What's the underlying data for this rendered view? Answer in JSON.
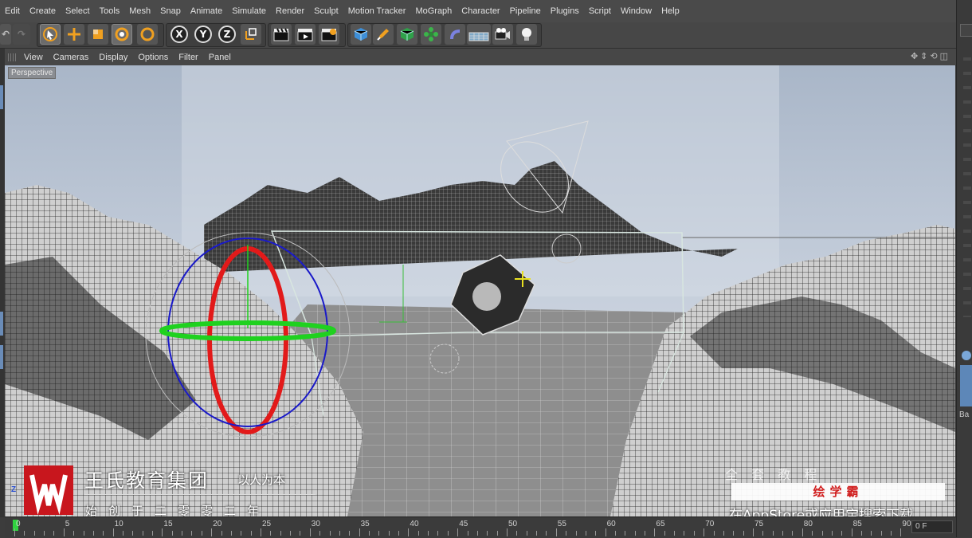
{
  "menubar": {
    "items": [
      "Edit",
      "Create",
      "Select",
      "Tools",
      "Mesh",
      "Snap",
      "Animate",
      "Simulate",
      "Render",
      "Sculpt",
      "Motion Tracker",
      "MoGraph",
      "Character",
      "Pipeline",
      "Plugins",
      "Script",
      "Window",
      "Help"
    ]
  },
  "toolbar": {
    "axis_x": "X",
    "axis_y": "Y",
    "axis_z": "Z",
    "accent": "#f0a020"
  },
  "viewport": {
    "menu": [
      "View",
      "Cameras",
      "Display",
      "Options",
      "Filter",
      "Panel"
    ],
    "label": "Perspective",
    "axis_z_label": "Z"
  },
  "timeline": {
    "ticks": [
      "0",
      "5",
      "10",
      "15",
      "20",
      "25",
      "30",
      "35",
      "40",
      "45",
      "50",
      "55",
      "60",
      "65",
      "70",
      "75",
      "80",
      "85",
      "90"
    ],
    "current_frame": "0 F"
  },
  "watermark": {
    "title": "王氏教育集团",
    "slogan": "以人为本",
    "subtitle": "始创于二零零二年",
    "brand_color": "#c8161d"
  },
  "ad": {
    "top_text": "全 套 教 程",
    "badge": "绘学霸",
    "bottom_text": "在AppStore或应用宝搜索下载"
  },
  "right_panel": {
    "fragment": "Ba"
  }
}
